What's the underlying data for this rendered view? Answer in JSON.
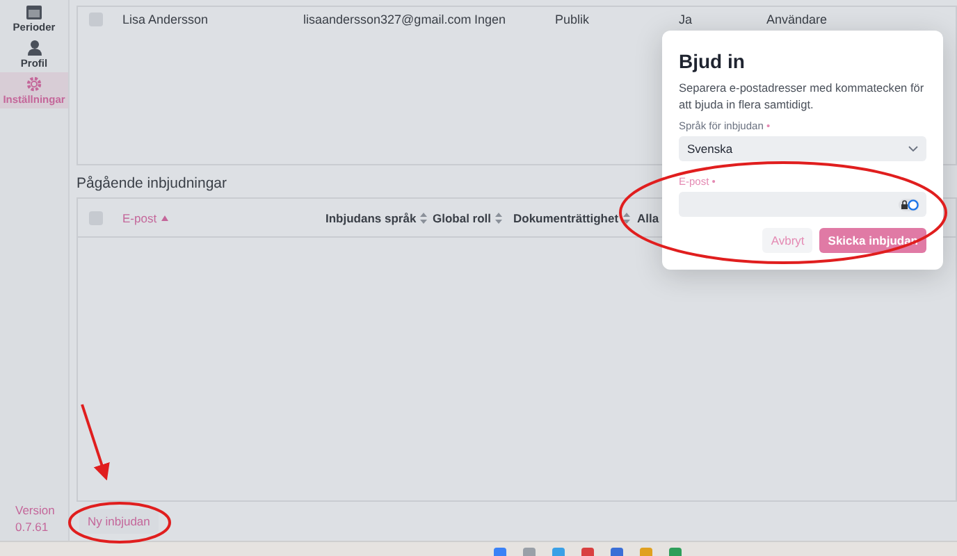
{
  "sidebar": {
    "items": [
      {
        "label": "Perioder",
        "kind": "calendar",
        "selected": false
      },
      {
        "label": "Profil",
        "kind": "person",
        "selected": false
      },
      {
        "label": "Inställningar",
        "kind": "gear",
        "selected": true
      }
    ],
    "version_label": "Version",
    "version_number": "0.7.61"
  },
  "users_table": {
    "rows": [
      {
        "checked": false,
        "cells": [
          "Lisa Andersson",
          "lisaandersson327@gmail.com",
          "Ingen",
          "Publik",
          "Ja",
          "Användare"
        ]
      }
    ]
  },
  "pending": {
    "title": "Pågående inbjudningar",
    "select_all_checked": false,
    "columns": [
      {
        "label": "E-post",
        "sorted": true
      },
      {
        "label": "Inbjudans språk",
        "sorted": false
      },
      {
        "label": "Global roll",
        "sorted": false
      },
      {
        "label": "Dokumenträttighet",
        "sorted": false
      },
      {
        "label": "Alla",
        "sorted": false
      }
    ]
  },
  "new_invite_button": "Ny inbjudan",
  "dialog": {
    "title": "Bjud in",
    "description": "Separera e-postadresser med kommatecken för att bjuda in flera samtidigt.",
    "language_label": {
      "text": "Språk för inbjudan",
      "required_mark": "•"
    },
    "language_value": "Svenska",
    "email_label": {
      "text": "E-post",
      "required_mark": "•"
    },
    "cancel": "Avbryt",
    "submit": "Skicka inbjudan"
  }
}
